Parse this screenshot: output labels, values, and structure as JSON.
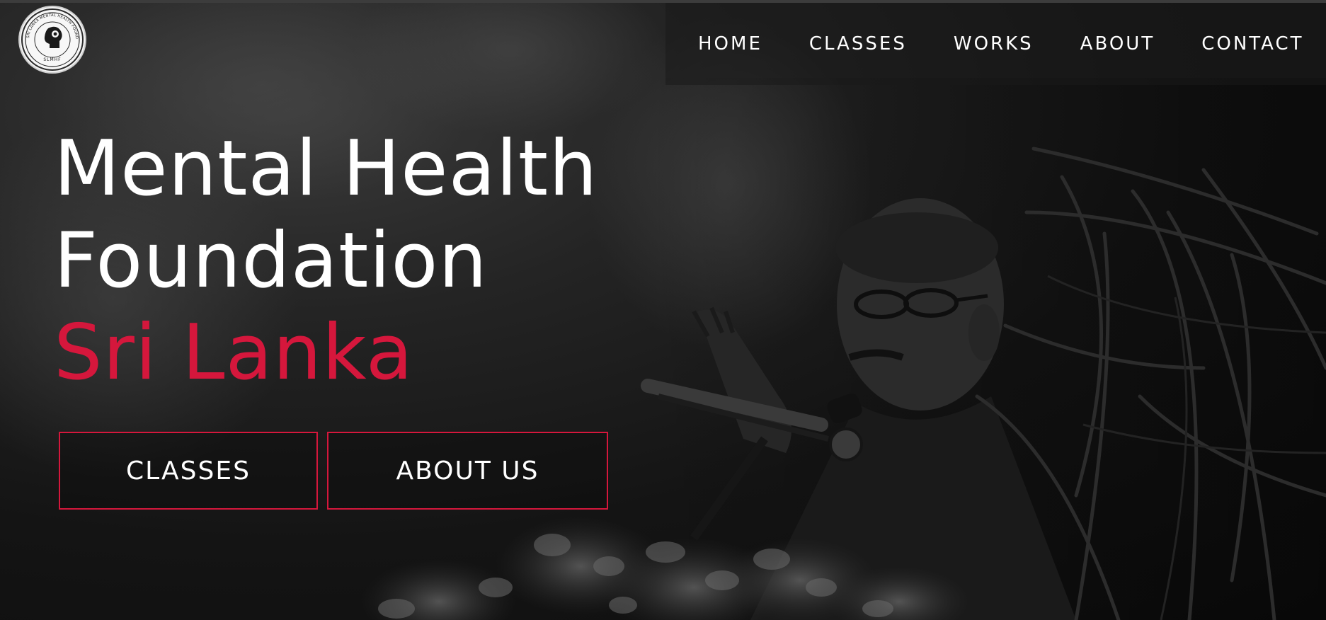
{
  "logo": {
    "ring_text": "SRI LANKA MENTAL HEALTH FOUNDATION",
    "initials": "SLMHF",
    "icon": "head-silhouette-icon"
  },
  "nav": {
    "items": [
      {
        "label": "HOME"
      },
      {
        "label": "CLASSES"
      },
      {
        "label": "WORKS"
      },
      {
        "label": "ABOUT"
      },
      {
        "label": "CONTACT"
      }
    ]
  },
  "hero": {
    "title_line1": "Mental Health",
    "title_line2": "Foundation",
    "title_line3": "Sri Lanka"
  },
  "buttons": {
    "classes_label": "CLASSES",
    "about_label": "ABOUT US"
  },
  "colors": {
    "accent": "#d5173c",
    "text": "#ffffff",
    "background": "#0d0d0d"
  }
}
